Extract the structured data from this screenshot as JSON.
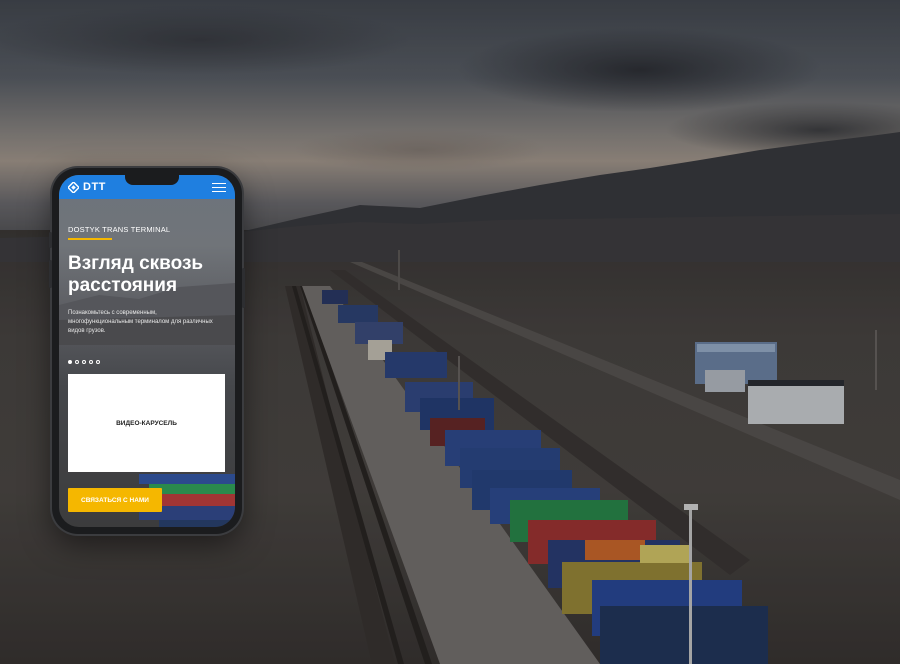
{
  "brand": {
    "name": "DTT",
    "accent_color": "#1f7fe0",
    "cta_color": "#f5b700"
  },
  "header": {
    "logo_icon": "dtt-logo-diamond-icon",
    "menu_icon": "hamburger-menu-icon"
  },
  "hero": {
    "eyebrow": "DOSTYK TRANS TERMINAL",
    "title": "Взгляд сквозь расстояния",
    "description": "Познакомьтесь с современным, многофункциональным терминалом для различных видов грузов.",
    "slides_total": 5,
    "slide_active": 1
  },
  "video": {
    "placeholder": "ВИДЕО-КАРУСЕЛЬ"
  },
  "cta": {
    "label": "СВЯЗАТЬСЯ С НАМИ"
  }
}
